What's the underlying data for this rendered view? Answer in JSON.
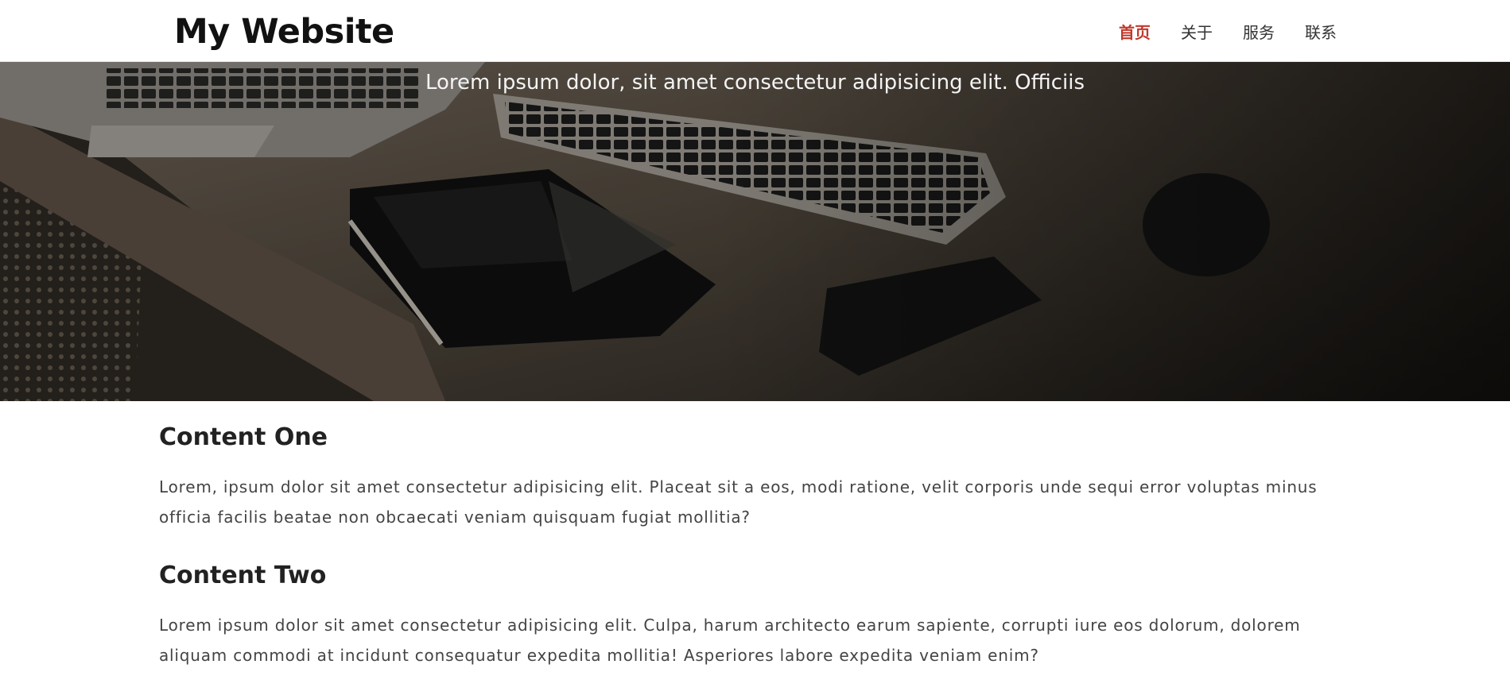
{
  "header": {
    "brand": "My Website",
    "nav": [
      {
        "label": "首页",
        "active": true
      },
      {
        "label": "关于",
        "active": false
      },
      {
        "label": "服务",
        "active": false
      },
      {
        "label": "联系",
        "active": false
      }
    ],
    "active_color": "#c0392b"
  },
  "hero": {
    "text": "Lorem ipsum dolor, sit amet consectetur adipisicing elit. Officiis"
  },
  "content": [
    {
      "heading": "Content One",
      "body": "Lorem, ipsum dolor sit amet consectetur adipisicing elit. Placeat sit a eos, modi ratione, velit corporis unde sequi error voluptas minus officia facilis beatae non obcaecati veniam quisquam fugiat mollitia?"
    },
    {
      "heading": "Content Two",
      "body": "Lorem ipsum dolor sit amet consectetur adipisicing elit. Culpa, harum architecto earum sapiente, corrupti iure eos dolorum, dolorem aliquam commodi at incidunt consequatur expedita mollitia! Asperiores labore expedita veniam enim?"
    }
  ]
}
